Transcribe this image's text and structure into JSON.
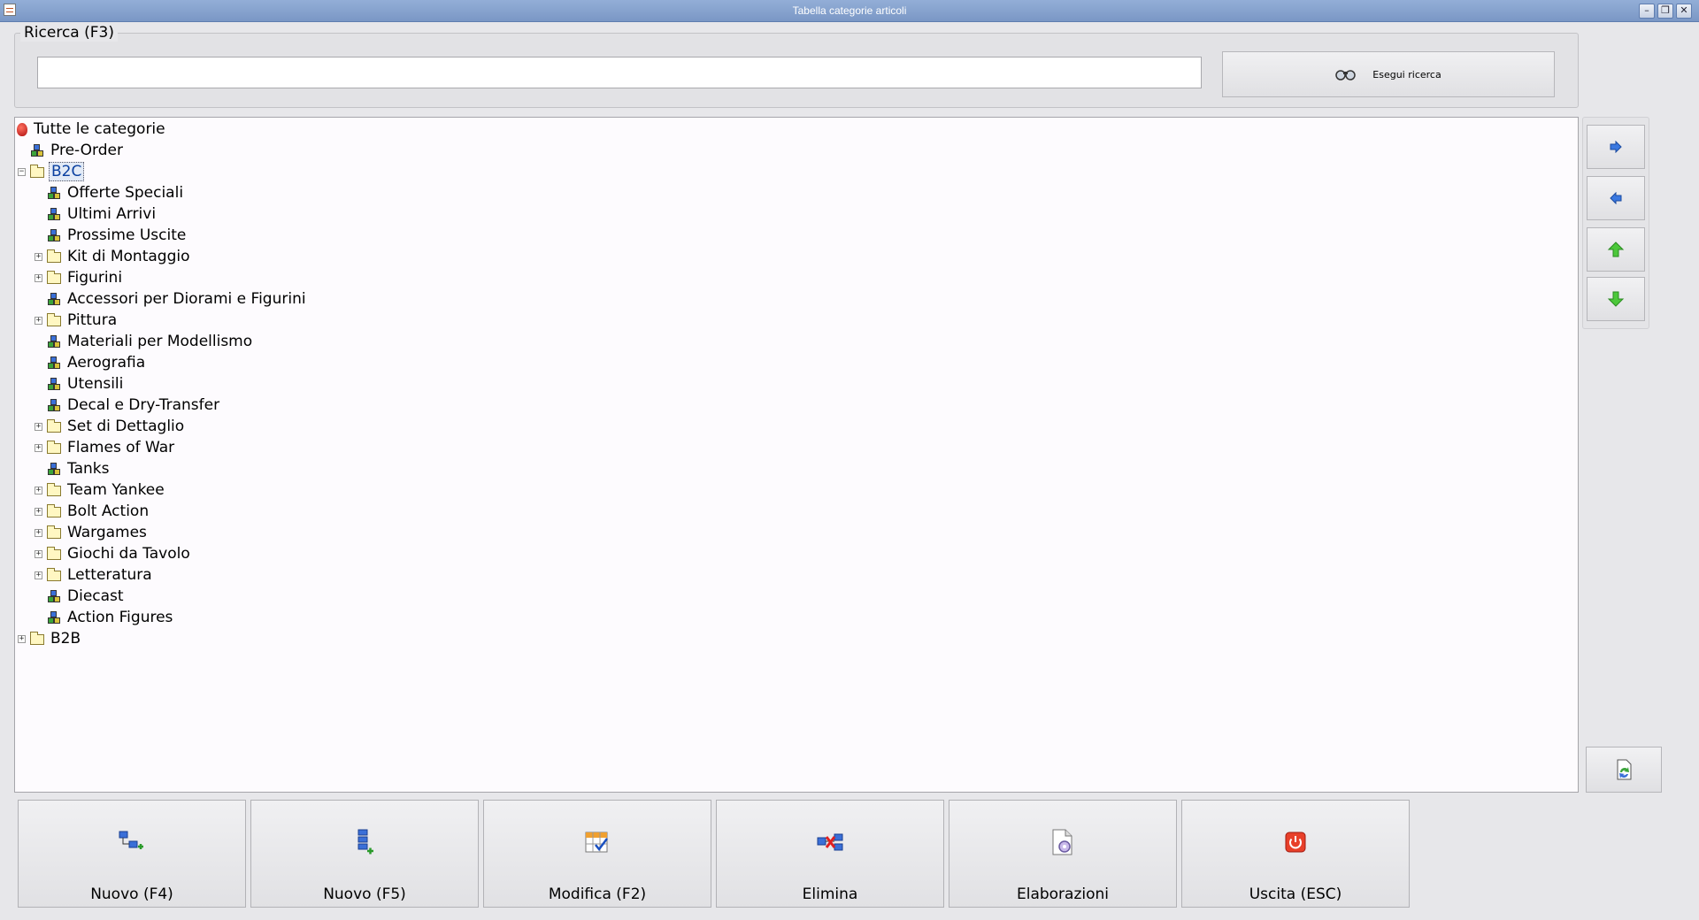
{
  "window": {
    "title": "Tabella categorie articoli"
  },
  "search": {
    "group_label": "Ricerca (F3)",
    "value": "",
    "button_label": "Esegui ricerca"
  },
  "tree": {
    "root": "Tutte le categorie",
    "items": [
      {
        "label": "Pre-Order",
        "level": 1,
        "type": "leaf",
        "expander": ""
      },
      {
        "label": "B2C",
        "level": 1,
        "type": "folder",
        "expander": "−",
        "selected": true
      },
      {
        "label": "Offerte Speciali",
        "level": 2,
        "type": "leaf",
        "expander": ""
      },
      {
        "label": "Ultimi Arrivi",
        "level": 2,
        "type": "leaf",
        "expander": ""
      },
      {
        "label": "Prossime Uscite",
        "level": 2,
        "type": "leaf",
        "expander": ""
      },
      {
        "label": "Kit di Montaggio",
        "level": 2,
        "type": "folder",
        "expander": "+"
      },
      {
        "label": "Figurini",
        "level": 2,
        "type": "folder",
        "expander": "+"
      },
      {
        "label": "Accessori per Diorami e Figurini",
        "level": 2,
        "type": "leaf",
        "expander": ""
      },
      {
        "label": "Pittura",
        "level": 2,
        "type": "folder",
        "expander": "+"
      },
      {
        "label": "Materiali per Modellismo",
        "level": 2,
        "type": "leaf",
        "expander": ""
      },
      {
        "label": "Aerografia",
        "level": 2,
        "type": "leaf",
        "expander": ""
      },
      {
        "label": "Utensili",
        "level": 2,
        "type": "leaf",
        "expander": ""
      },
      {
        "label": "Decal e Dry-Transfer",
        "level": 2,
        "type": "leaf",
        "expander": ""
      },
      {
        "label": "Set di Dettaglio",
        "level": 2,
        "type": "folder",
        "expander": "+"
      },
      {
        "label": "Flames of War",
        "level": 2,
        "type": "folder",
        "expander": "+"
      },
      {
        "label": "Tanks",
        "level": 2,
        "type": "leaf",
        "expander": ""
      },
      {
        "label": "Team Yankee",
        "level": 2,
        "type": "folder",
        "expander": "+"
      },
      {
        "label": "Bolt Action",
        "level": 2,
        "type": "folder",
        "expander": "+"
      },
      {
        "label": "Wargames",
        "level": 2,
        "type": "folder",
        "expander": "+"
      },
      {
        "label": "Giochi da Tavolo",
        "level": 2,
        "type": "folder",
        "expander": "+"
      },
      {
        "label": "Letteratura",
        "level": 2,
        "type": "folder",
        "expander": "+"
      },
      {
        "label": "Diecast",
        "level": 2,
        "type": "leaf",
        "expander": ""
      },
      {
        "label": "Action Figures",
        "level": 2,
        "type": "leaf",
        "expander": ""
      },
      {
        "label": "B2B",
        "level": 1,
        "type": "folder",
        "expander": "+"
      }
    ]
  },
  "side_buttons": [
    "arrow-right-icon",
    "arrow-left-icon",
    "arrow-up-icon",
    "arrow-down-icon"
  ],
  "toolbar": {
    "new_f4": "Nuovo (F4)",
    "new_f5": "Nuovo (F5)",
    "edit": "Modifica (F2)",
    "delete": "Elimina",
    "processing": "Elaborazioni",
    "exit": "Uscita (ESC)"
  },
  "colors": {
    "titlebar": "#7a97c5",
    "tree_background": "#fdfbfe",
    "selection": "#0a40a0"
  }
}
